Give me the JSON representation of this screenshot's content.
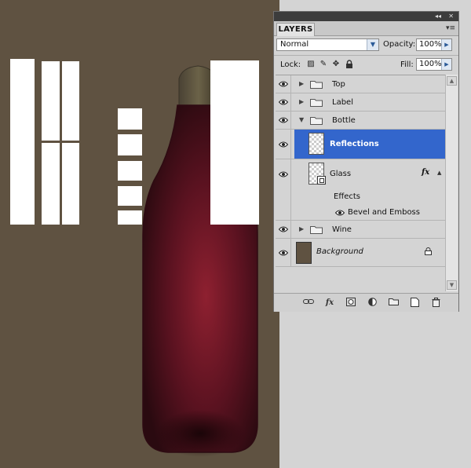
{
  "panel": {
    "title": "LAYERS",
    "collapse_glyph": "◂◂",
    "close_glyph": "✕",
    "menu_glyph": "▾≡",
    "blend_mode": "Normal",
    "opacity_label": "Opacity:",
    "opacity_value": "100%",
    "lock_label": "Lock:",
    "fill_label": "Fill:",
    "fill_value": "100%"
  },
  "layers": [
    {
      "name": "Top",
      "type": "group",
      "expanded": false
    },
    {
      "name": "Label",
      "type": "group",
      "expanded": false
    },
    {
      "name": "Bottle",
      "type": "group",
      "expanded": true
    },
    {
      "name": "Reflections",
      "type": "layer",
      "selected": true
    },
    {
      "name": "Glass",
      "type": "layer",
      "fx": "fx"
    },
    {
      "name": "Effects",
      "type": "effects-header"
    },
    {
      "name": "Bevel and Emboss",
      "type": "effect"
    },
    {
      "name": "Wine",
      "type": "group",
      "expanded": false
    },
    {
      "name": "Background",
      "type": "background",
      "locked": true
    }
  ],
  "colors": {
    "canvas_bg": "#5f5241",
    "selected_row": "#3366cc",
    "bottle_red": "#8e2030"
  },
  "bottom_icons": [
    "link-icon",
    "fx-icon",
    "mask-icon",
    "adjustment-icon",
    "new-group-icon",
    "new-layer-icon",
    "trash-icon"
  ]
}
